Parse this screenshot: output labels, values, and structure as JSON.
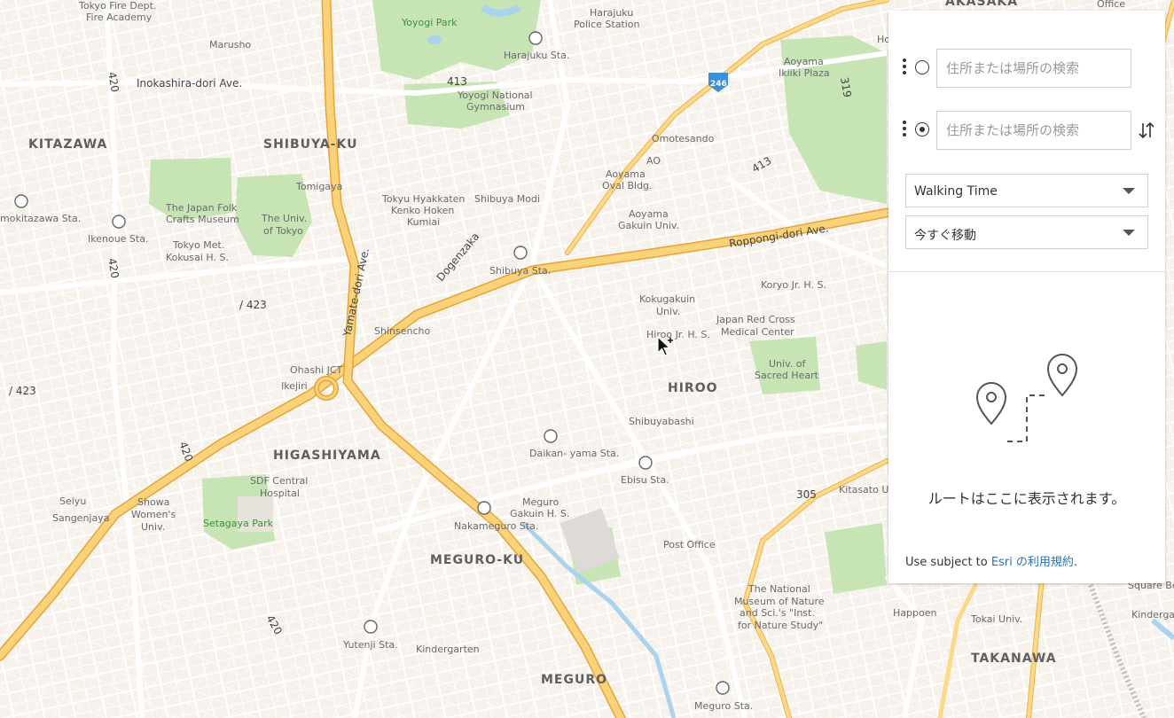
{
  "map": {
    "district_labels": [
      "KITAZAWA",
      "SHIBUYA-KU",
      "HIGASHIYAMA",
      "MEGURO-KU",
      "MEGURO",
      "HIROO",
      "TAKANAWA",
      "AKASAKA"
    ],
    "road_labels": [
      "Inokashira-dori Ave.",
      "Roppongi-dori Ave.",
      "Yamate-dori Ave.",
      "Dogenzaka",
      "413",
      "413",
      "420",
      "420",
      "420",
      "420",
      "/ 423",
      "/ 423",
      "305",
      "319",
      "246"
    ],
    "station_labels": [
      "Harajuku Sta.",
      "Shibuya Sta.",
      "Ikenoue Sta.",
      "Daikan-\nyama Sta.",
      "Ebisu Sta.",
      "Nakameguro Sta.",
      "Yutenji Sta.",
      "Meguro Sta.",
      "Kitasato U",
      "mokitazawa Sta."
    ],
    "place_labels": [
      "Tokyo Fire Dept.",
      "Fire Academy",
      "Yoyogi Park",
      "Harajuku",
      "Police Station",
      "Marusho",
      "Yoyogi National",
      "Gymnasium",
      "Aoyama",
      "Ikiiki Plaza",
      "Omotesando",
      "AO",
      "Aoyama",
      "Oval Bldg.",
      "Tomigaya",
      "Tokyu Hyakkaten",
      "Kenko Hoken",
      "Kumiai",
      "Shibuya Modi",
      "The Japan Folk",
      "Crafts Museum",
      "The Univ.",
      "of Tokyo",
      "Tokyo Met.",
      "Kokusai H. S.",
      "Aoyama",
      "Gakuin Univ.",
      "Koryo Jr. H. S.",
      "Kokugakuin",
      "Univ.",
      "Japan Red Cross",
      "Medical Center",
      "Hiroo Jr. H. S.",
      "Shinsencho",
      "Ohashi JCT",
      "Ikejiri",
      "Univ. of",
      "Sacred Heart",
      "Shibuyabashi",
      "SDF Central",
      "Hospital",
      "Setagaya Park",
      "Seiyu",
      "Sangenjaya",
      "Showa",
      "Women's",
      "Univ.",
      "Meguro",
      "Gakuin H. S.",
      "Post Office",
      "The National",
      "Museum of Nature",
      "and Sci.'s \"Inst.",
      "for Nature Study\"",
      "Happoen",
      "Tokai Univ.",
      "Kindergarten",
      "Square Be",
      "Kinderga",
      "Office",
      "Ho"
    ]
  },
  "panel": {
    "origin_placeholder": "住所または場所の検索",
    "destination_placeholder": "住所または場所の検索",
    "travel_mode": "Walking Time",
    "depart_time": "今すぐ移動",
    "empty_message": "ルートはここに表示されます。",
    "terms_prefix": "Use subject to ",
    "terms_link": "Esri の利用規約",
    "terms_suffix": "."
  },
  "colors": {
    "map_bg": "#f3eee8",
    "park": "#c6e4b4",
    "highway": "#f7c95f",
    "water": "#a9d3ee",
    "link": "#2a6fb0"
  }
}
